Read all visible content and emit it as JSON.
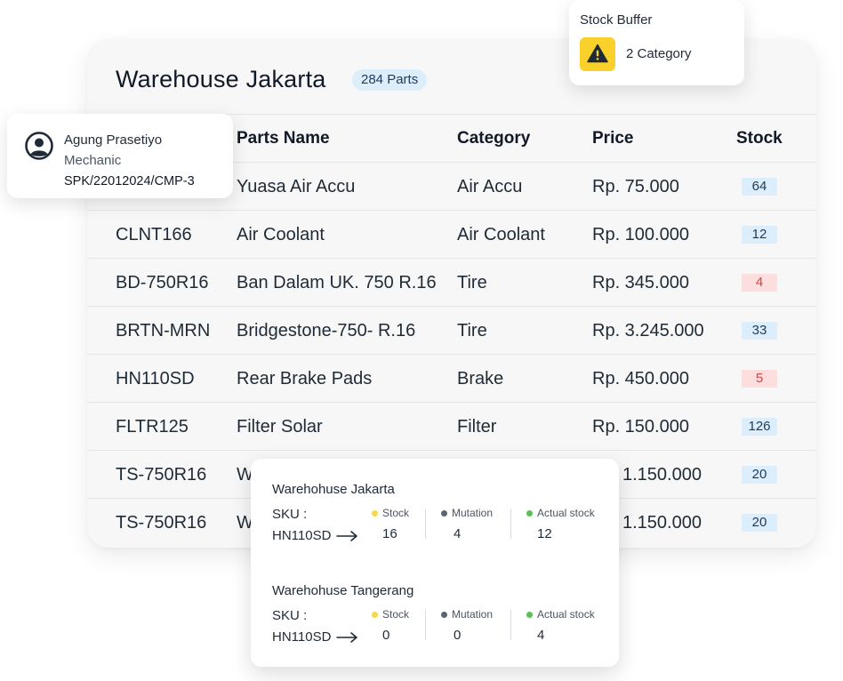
{
  "warehouse": {
    "title": "Warehouse Jakarta",
    "parts_badge": "284 Parts",
    "columns": {
      "name": "Parts Name",
      "category": "Category",
      "price": "Price",
      "stock": "Stock"
    },
    "rows": [
      {
        "sku": "",
        "name": "Yuasa Air Accu",
        "category": "Air Accu",
        "price": "Rp. 75.000",
        "stock": "64",
        "low": false
      },
      {
        "sku": "CLNT166",
        "name": "Air Coolant",
        "category": "Air Coolant",
        "price": "Rp. 100.000",
        "stock": "12",
        "low": false
      },
      {
        "sku": "BD-750R16",
        "name": "Ban Dalam UK. 750 R.16",
        "category": "Tire",
        "price": "Rp. 345.000",
        "stock": "4",
        "low": true
      },
      {
        "sku": "BRTN-MRN",
        "name": "Bridgestone-750- R.16",
        "category": "Tire",
        "price": "Rp. 3.245.000",
        "stock": "33",
        "low": false
      },
      {
        "sku": "HN110SD",
        "name": "Rear Brake Pads",
        "category": "Brake",
        "price": "Rp. 450.000",
        "stock": "5",
        "low": true
      },
      {
        "sku": "FLTR125",
        "name": "Filter Solar",
        "category": "Filter",
        "price": "Rp. 150.000",
        "stock": "126",
        "low": false
      },
      {
        "sku": "TS-750R16",
        "name": "W",
        "category": "",
        "price": "1.150.000",
        "stock": "20",
        "low": false
      },
      {
        "sku": "TS-750R16",
        "name": "W",
        "category": "",
        "price": "1.150.000",
        "stock": "20",
        "low": false
      }
    ]
  },
  "mechanic": {
    "name": "Agung Prasetiyo",
    "role": "Mechanic",
    "spk": "SPK/22012024/CMP-3",
    "icon": "user-circle-icon"
  },
  "buffer": {
    "title": "Stock Buffer",
    "value": "2 Category",
    "icon": "warning-icon",
    "color": "#f9d12a"
  },
  "sku_detail": {
    "sku_label": "SKU :",
    "sections": [
      {
        "title": "Warehohuse Jakarta",
        "sku": "HN110SD",
        "stock_label": "Stock",
        "stock": "16",
        "mutation_label": "Mutation",
        "mutation": "4",
        "actual_label": "Actual stock",
        "actual": "12"
      },
      {
        "title": "Warehohuse Tangerang",
        "sku": "HN110SD",
        "stock_label": "Stock",
        "stock": "0",
        "mutation_label": "Mutation",
        "mutation": "0",
        "actual_label": "Actual stock",
        "actual": "4"
      }
    ],
    "colors": {
      "stock": "#f5d94a",
      "mutation": "#5b6472",
      "actual": "#5cbf5c"
    }
  }
}
